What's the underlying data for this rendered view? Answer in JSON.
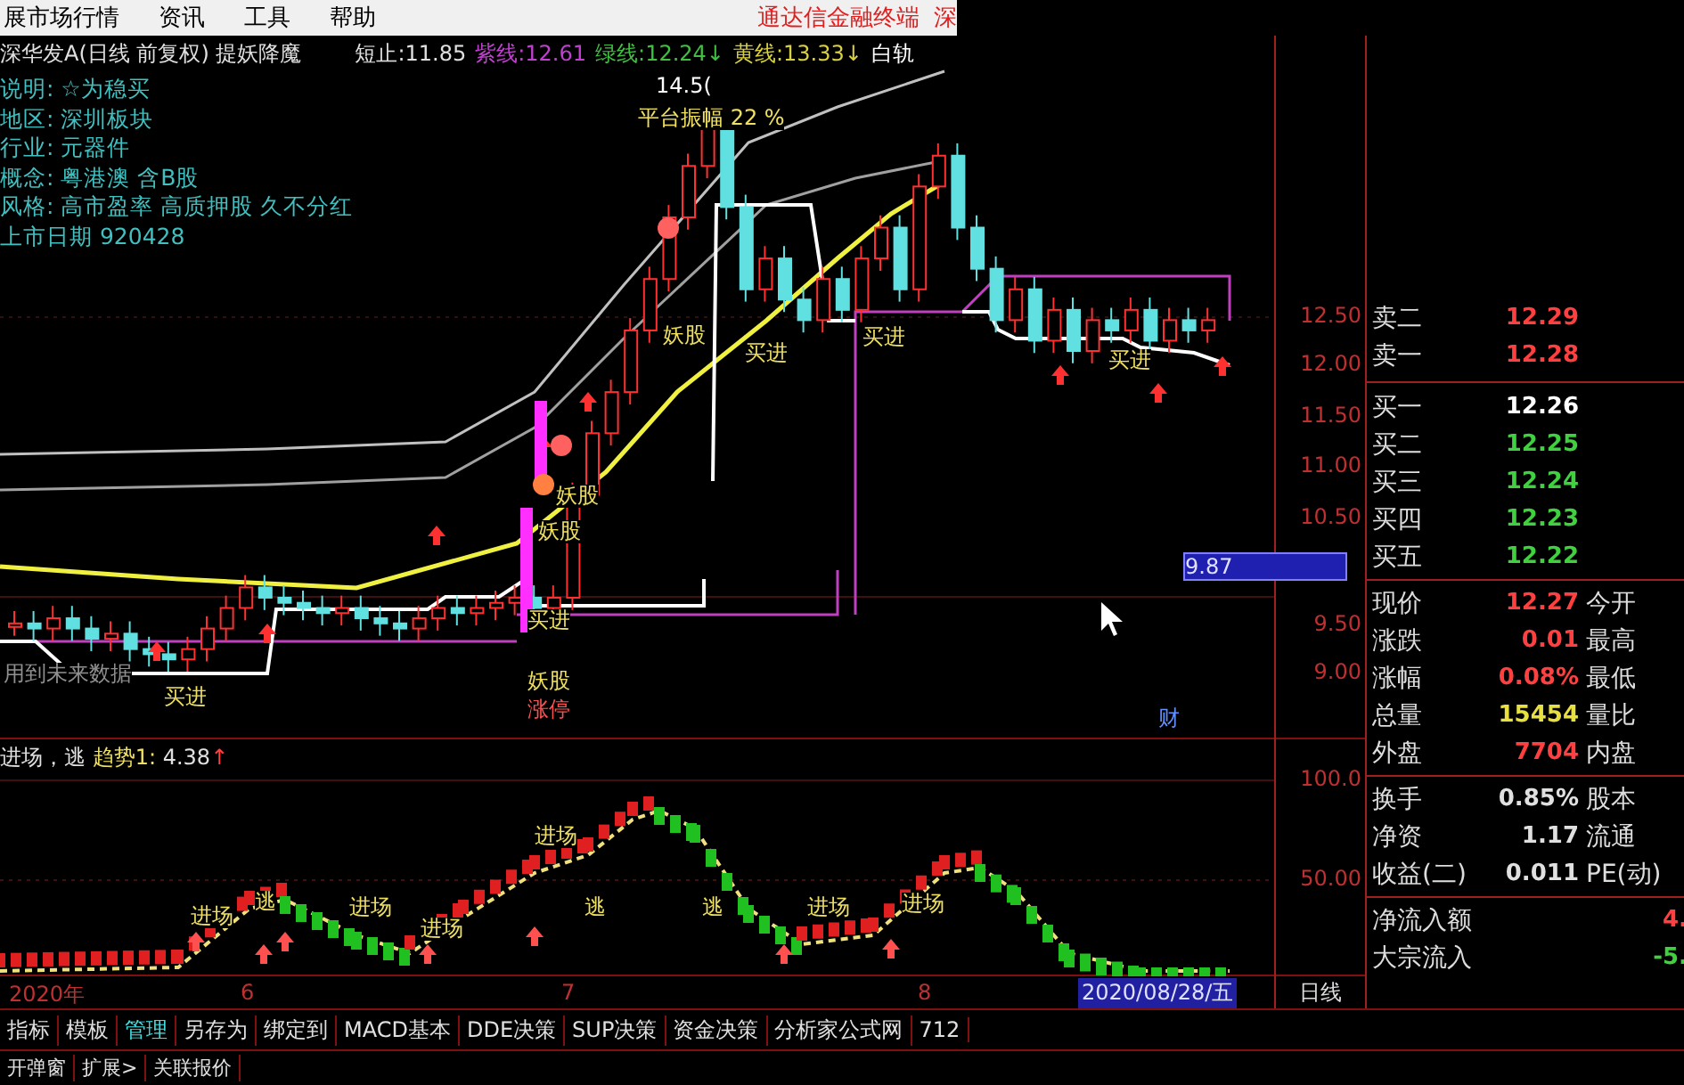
{
  "menu": [
    {
      "label": "展市场行情"
    },
    {
      "label": "资讯"
    },
    {
      "label": "工具"
    },
    {
      "label": "帮助"
    }
  ],
  "app_title": "通达信金融终端",
  "app_title_cut": "深",
  "chart_title": "深华发A(日线 前复权) 提妖降魔",
  "indicator_values": [
    {
      "label": "短止:",
      "value": "11.85",
      "color": "#e0e0e0"
    },
    {
      "label": "紫线:",
      "value": "12.61",
      "color": "#c040d0"
    },
    {
      "label": "绿线:",
      "value": "12.24↓",
      "color": "#40c040"
    },
    {
      "label": "黄线:",
      "value": "13.33↓",
      "color": "#d8d040"
    },
    {
      "label": "白轨",
      "color": "#ffffff"
    }
  ],
  "info": [
    {
      "label": "说明:",
      "value": "☆为稳买"
    },
    {
      "label": "地区:",
      "value": "深圳板块"
    },
    {
      "label": "行业:",
      "value": "元器件"
    },
    {
      "label": "概念:",
      "value": "粤港澳 含B股"
    },
    {
      "label": "风格:",
      "value": "高市盈率 高质押股 久不分红"
    },
    {
      "label": "上市日期",
      "value": "920428"
    }
  ],
  "chart_annotations": [
    "14.5(",
    "平台振幅 22 %",
    "妖股",
    "买进",
    "买进",
    "买进",
    "妖股",
    "妖股",
    "买进",
    "妖股",
    "涨停",
    "买进",
    "用到未来数据",
    "财"
  ],
  "price_axis": [
    "12.50",
    "12.00",
    "11.50",
    "11.00",
    "10.50",
    "9.87",
    "9.50",
    "9.00"
  ],
  "indicator_header": {
    "signals": "进场，逃",
    "trend_label": "趋势1:",
    "trend_value": "4.38",
    "trend_arrow": "↑"
  },
  "indicator_annotations": [
    "进场",
    "逃",
    "进场",
    "进场",
    "进场",
    "逃",
    "逃",
    "进场",
    "进场"
  ],
  "indicator_axis": [
    "100.0",
    "50.00"
  ],
  "order_book": [
    {
      "label": "卖二",
      "value": "12.29",
      "color": "#ff4040"
    },
    {
      "label": "卖一",
      "value": "12.28",
      "color": "#ff4040"
    },
    {
      "label": "买一",
      "value": "12.26",
      "color": "#ffffff"
    },
    {
      "label": "买二",
      "value": "12.25",
      "color": "#40d040"
    },
    {
      "label": "买三",
      "value": "12.24",
      "color": "#40d040"
    },
    {
      "label": "买四",
      "value": "12.23",
      "color": "#40d040"
    },
    {
      "label": "买五",
      "value": "12.22",
      "color": "#40d040"
    }
  ],
  "stats": [
    {
      "label": "现价",
      "value": "12.27",
      "label2": "今开",
      "color": "#ff4040"
    },
    {
      "label": "涨跌",
      "value": "0.01",
      "label2": "最高",
      "color": "#ff4040"
    },
    {
      "label": "涨幅",
      "value": "0.08%",
      "label2": "最低",
      "color": "#ff4040"
    },
    {
      "label": "总量",
      "value": "15454",
      "label2": "量比",
      "color": "#e8e040"
    },
    {
      "label": "外盘",
      "value": "7704",
      "label2": "内盘",
      "color": "#ff4040"
    }
  ],
  "stats2": [
    {
      "label": "换手",
      "value": "0.85%",
      "label2": "股本",
      "color": "#e0e0e0"
    },
    {
      "label": "净资",
      "value": "1.17",
      "label2": "流通",
      "color": "#e0e0e0"
    },
    {
      "label": "收益(二)",
      "value": "0.011",
      "label2": "PE(动)",
      "color": "#e0e0e0"
    }
  ],
  "flows": [
    {
      "label": "净流入额",
      "value": "4.",
      "color": "#ff4040"
    },
    {
      "label": "大宗流入",
      "value": "-5.",
      "color": "#40d040"
    }
  ],
  "date_axis": [
    "2020年",
    "6",
    "7",
    "8"
  ],
  "current_date": "2020/08/28/五",
  "period": "日线",
  "tabs": [
    {
      "label": "指标",
      "selected": false
    },
    {
      "label": "模板",
      "selected": false
    },
    {
      "label": "管理",
      "selected": true
    },
    {
      "label": "另存为",
      "selected": false
    },
    {
      "label": "绑定到",
      "selected": false
    },
    {
      "label": "MACD基本",
      "selected": false
    },
    {
      "label": "DDE决策",
      "selected": false
    },
    {
      "label": "SUP决策",
      "selected": false
    },
    {
      "label": "资金决策",
      "selected": false
    },
    {
      "label": "分析家公式网",
      "selected": false
    },
    {
      "label": "712",
      "selected": false
    }
  ],
  "bottom_buttons": [
    "开弹窗",
    "扩展>",
    "关联报价"
  ]
}
